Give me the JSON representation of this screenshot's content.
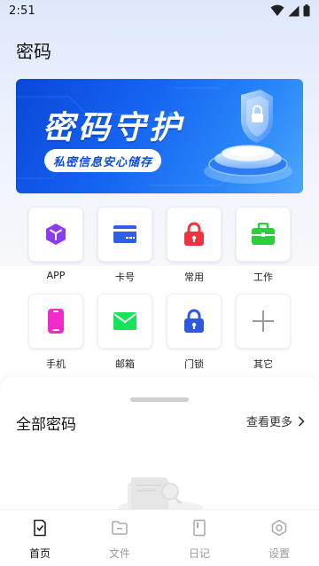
{
  "status_bar": {
    "time": "2:51"
  },
  "page_title": "密码",
  "banner": {
    "title": "密码守护",
    "tag": "私密信息安心储存"
  },
  "categories": [
    {
      "label": "APP",
      "icon": "cube-icon",
      "color": "#8b3cf0"
    },
    {
      "label": "卡号",
      "icon": "card-icon",
      "color": "#2f5ee8"
    },
    {
      "label": "常用",
      "icon": "lock-icon",
      "color": "#f0333f"
    },
    {
      "label": "工作",
      "icon": "briefcase-icon",
      "color": "#2ad03c"
    },
    {
      "label": "手机",
      "icon": "phone-icon",
      "color": "#f12bc7"
    },
    {
      "label": "邮箱",
      "icon": "mail-icon",
      "color": "#17e35a"
    },
    {
      "label": "门锁",
      "icon": "padlock-icon",
      "color": "#2f58e0"
    },
    {
      "label": "其它",
      "icon": "plus-icon",
      "color": "#9a9a9a"
    }
  ],
  "all_passwords": {
    "title": "全部密码",
    "more": "查看更多"
  },
  "bottom_nav": [
    {
      "label": "首页",
      "icon": "home-doc-icon",
      "active": true
    },
    {
      "label": "文件",
      "icon": "folder-icon",
      "active": false
    },
    {
      "label": "日记",
      "icon": "notebook-icon",
      "active": false
    },
    {
      "label": "设置",
      "icon": "settings-icon",
      "active": false
    }
  ]
}
